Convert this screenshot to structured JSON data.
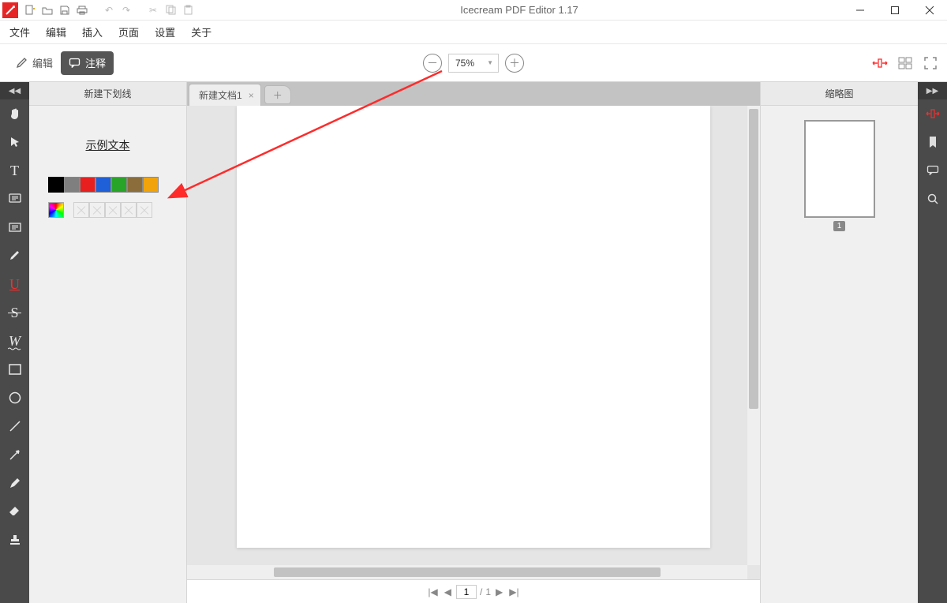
{
  "app": {
    "title": "Icecream PDF Editor 1.17"
  },
  "menu": {
    "file": "文件",
    "edit": "编辑",
    "insert": "插入",
    "page": "页面",
    "settings": "设置",
    "about": "关于"
  },
  "mode": {
    "edit_label": "编辑",
    "annotate_label": "注释"
  },
  "zoom": {
    "value": "75%"
  },
  "left_panel": {
    "title": "新建下划线",
    "sample": "示例文本"
  },
  "colors": {
    "row": [
      "#000000",
      "#7f7f7f",
      "#e81f1f",
      "#1f5fd8",
      "#28a428",
      "#8a6d3b",
      "#f0a30a"
    ],
    "selected_index": 0
  },
  "document": {
    "tab_label": "新建文档1"
  },
  "right_panel": {
    "title": "缩略图",
    "page_number": "1"
  },
  "pager": {
    "current": "1",
    "total": "1",
    "separator": "/"
  }
}
